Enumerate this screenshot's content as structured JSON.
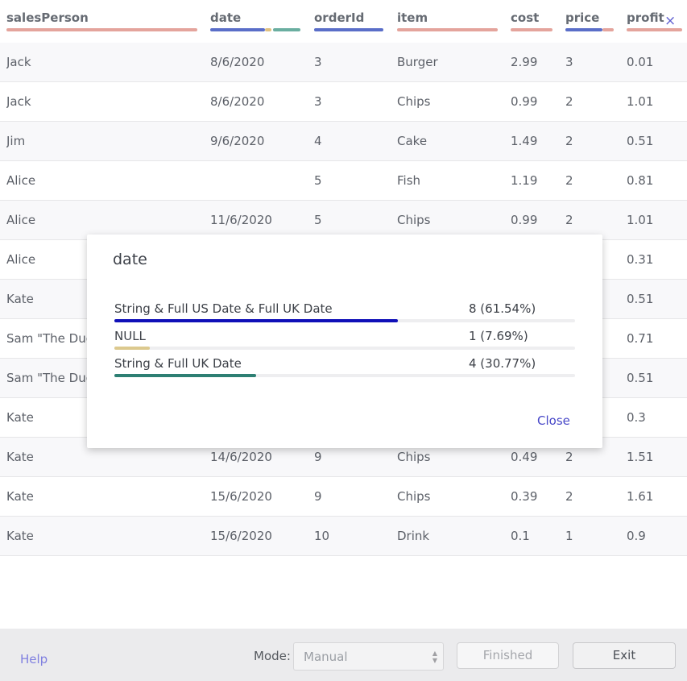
{
  "table": {
    "columns": [
      {
        "key": "salesPerson",
        "label": "salesPerson"
      },
      {
        "key": "date",
        "label": "date"
      },
      {
        "key": "orderId",
        "label": "orderId"
      },
      {
        "key": "item",
        "label": "item"
      },
      {
        "key": "cost",
        "label": "cost"
      },
      {
        "key": "price",
        "label": "price"
      },
      {
        "key": "profit",
        "label": "profit"
      }
    ],
    "close_symbol": "×",
    "rows": [
      [
        "Jack",
        "8/6/2020",
        "3",
        "Burger",
        "2.99",
        "3",
        "0.01"
      ],
      [
        "Jack",
        "8/6/2020",
        "3",
        "Chips",
        "0.99",
        "2",
        "1.01"
      ],
      [
        "Jim",
        "9/6/2020",
        "4",
        "Cake",
        "1.49",
        "2",
        "0.51"
      ],
      [
        "Alice",
        "",
        "5",
        "Fish",
        "1.19",
        "2",
        "0.81"
      ],
      [
        "Alice",
        "11/6/2020",
        "5",
        "Chips",
        "0.99",
        "2",
        "1.01"
      ],
      [
        "Alice",
        "",
        "",
        "",
        "",
        "",
        "0.31"
      ],
      [
        "Kate",
        "",
        "",
        "",
        "",
        "",
        "0.51"
      ],
      [
        "Sam \"The Dud",
        "",
        "",
        "",
        "",
        "",
        "0.71"
      ],
      [
        "Sam \"The Dud",
        "",
        "",
        "",
        "",
        "",
        "0.51"
      ],
      [
        "Kate",
        "",
        "",
        "",
        "",
        "",
        "0.3"
      ],
      [
        "Kate",
        "14/6/2020",
        "9",
        "Chips",
        "0.49",
        "2",
        "1.51"
      ],
      [
        "Kate",
        "15/6/2020",
        "9",
        "Chips",
        "0.39",
        "2",
        "1.61"
      ],
      [
        "Kate",
        "15/6/2020",
        "10",
        "Drink",
        "0.1",
        "1",
        "0.9"
      ]
    ]
  },
  "modal": {
    "title": "date",
    "stats": [
      {
        "label": "String & Full US Date & Full UK Date",
        "count": "8 (61.54%)",
        "fraction": 0.6154,
        "color": "#1010b8"
      },
      {
        "label": "NULL",
        "count": "1 (7.69%)",
        "fraction": 0.0769,
        "color": "#dcc98e"
      },
      {
        "label": "String & Full UK Date",
        "count": "4 (30.77%)",
        "fraction": 0.3077,
        "color": "#2d7f73"
      }
    ],
    "close_label": "Close"
  },
  "footer": {
    "help_label": "Help",
    "mode_label": "Mode:",
    "mode_value": "Manual",
    "finished_label": "Finished",
    "exit_label": "Exit"
  },
  "colors": {
    "header_red": "#e4a49c",
    "header_blue": "#5a6ec8",
    "header_teal": "#6aaea0",
    "header_gold": "#e0c080"
  },
  "icons": {
    "close": "close-icon",
    "select_arrows": "chevron-updown-icon"
  }
}
